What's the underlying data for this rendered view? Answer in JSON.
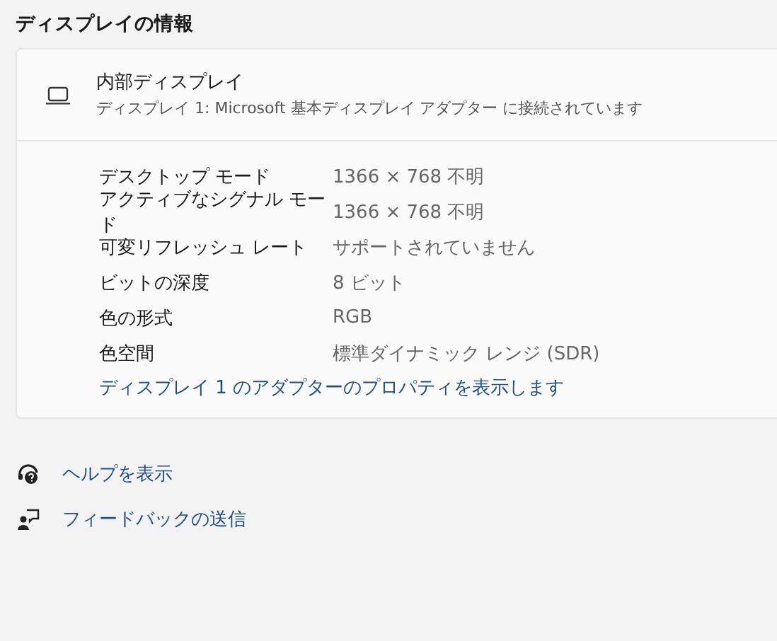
{
  "section_title": "ディスプレイの情報",
  "display": {
    "name": "内部ディスプレイ",
    "description": "ディスプレイ 1: Microsoft 基本ディスプレイ アダプター に接続されています"
  },
  "properties": [
    {
      "label": "デスクトップ モード",
      "value": "1366 × 768 不明"
    },
    {
      "label": "アクティブなシグナル モード",
      "value": "1366 × 768 不明"
    },
    {
      "label": "可変リフレッシュ レート",
      "value": "サポートされていません"
    },
    {
      "label": "ビットの深度",
      "value": "8 ビット"
    },
    {
      "label": "色の形式",
      "value": "RGB"
    },
    {
      "label": "色空間",
      "value": "標準ダイナミック レンジ (SDR)"
    }
  ],
  "adapter_link": "ディスプレイ 1 のアダプターのプロパティを表示します",
  "help_links": [
    {
      "kind": "help",
      "label": "ヘルプを表示"
    },
    {
      "kind": "feedback",
      "label": "フィードバックの送信"
    }
  ]
}
